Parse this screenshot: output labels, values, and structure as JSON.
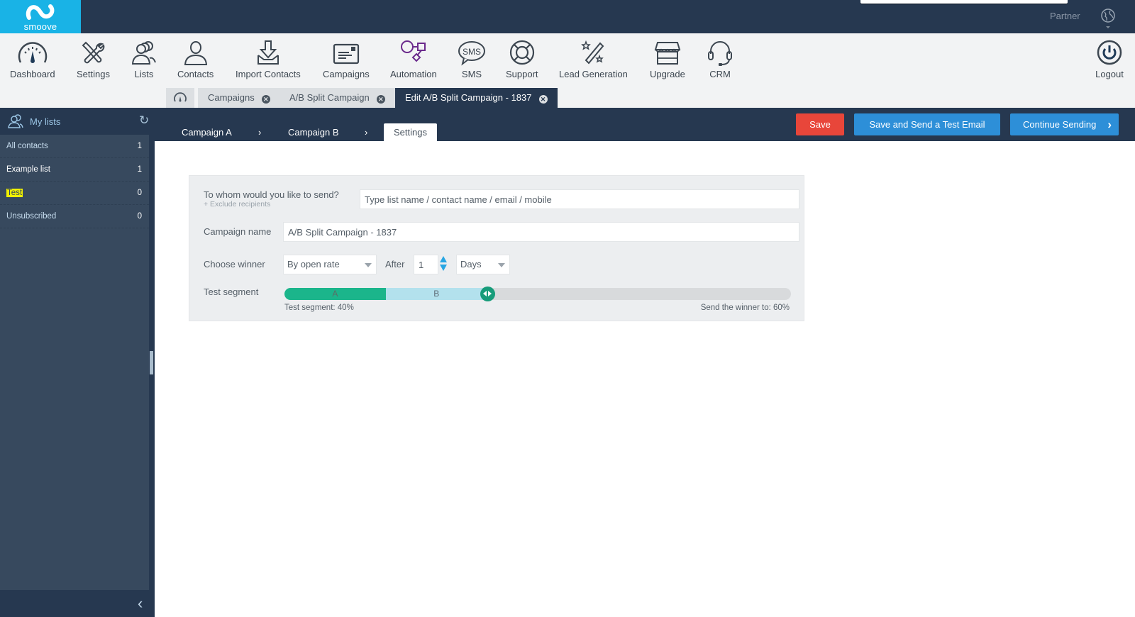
{
  "app": {
    "logo_text": "smoove",
    "partner_label": "Partner",
    "colors": {
      "topbar": "#263850",
      "logo_bg": "#19b3e6",
      "save_red": "#e8463a",
      "action_blue": "#2d8fd8",
      "segment_a": "#1bb58b",
      "segment_b": "#b3e1ed",
      "highlight": "#f1f100"
    }
  },
  "main_nav": {
    "items": [
      {
        "label": "Dashboard",
        "icon": "dashboard-gauge-icon"
      },
      {
        "label": "Settings",
        "icon": "tools-icon"
      },
      {
        "label": "Lists",
        "icon": "users-group-icon"
      },
      {
        "label": "Contacts",
        "icon": "user-icon"
      },
      {
        "label": "Import Contacts",
        "icon": "import-tray-icon"
      },
      {
        "label": "Campaigns",
        "icon": "newsletter-icon"
      },
      {
        "label": "Automation",
        "icon": "flow-shapes-icon"
      },
      {
        "label": "SMS",
        "icon": "sms-bubble-icon"
      },
      {
        "label": "Support",
        "icon": "lifebuoy-icon"
      },
      {
        "label": "Lead Generation",
        "icon": "magic-wand-icon"
      },
      {
        "label": "Upgrade",
        "icon": "store-icon"
      },
      {
        "label": "CRM",
        "icon": "headset-icon"
      }
    ],
    "logout_label": "Logout"
  },
  "tabs": {
    "home_icon": "dashboard-gauge-icon",
    "items": [
      {
        "label": "Campaigns",
        "active": false
      },
      {
        "label": "A/B Split Campaign",
        "active": false
      },
      {
        "label": "Edit A/B Split Campaign - 1837",
        "active": true
      }
    ]
  },
  "sidebar": {
    "title": "My lists",
    "lists": [
      {
        "name": "All contacts",
        "count": "1"
      },
      {
        "name": "Example list",
        "count": "1"
      },
      {
        "name": "Test",
        "count": "0",
        "highlighted": true
      },
      {
        "name": "Unsubscribed",
        "count": "0"
      }
    ]
  },
  "wizard": {
    "steps": [
      {
        "label": "Campaign A",
        "active": false
      },
      {
        "label": "Campaign B",
        "active": false
      },
      {
        "label": "Settings",
        "active": true
      }
    ],
    "separator": "›",
    "buttons": {
      "save": "Save",
      "save_test": "Save and Send a Test Email",
      "continue": "Continue Sending"
    }
  },
  "form": {
    "recipients_label": "To whom would you like to send?",
    "exclude_link": "+ Exclude recipients",
    "recipients_placeholder": "Type list name / contact name / email / mobile",
    "recipients_value": "",
    "campaign_name_label": "Campaign name",
    "campaign_name_value": "A/B Split Campaign - 1837",
    "choose_winner_label": "Choose winner",
    "winner_method": "By open rate",
    "after_label": "After",
    "after_value": "1",
    "after_unit": "Days",
    "test_segment_label": "Test segment",
    "segment_a_label": "A",
    "segment_b_label": "B",
    "test_segment_percent": 40,
    "test_segment_text": "Test segment: 40%",
    "winner_text": "Send the winner to: 60%"
  }
}
